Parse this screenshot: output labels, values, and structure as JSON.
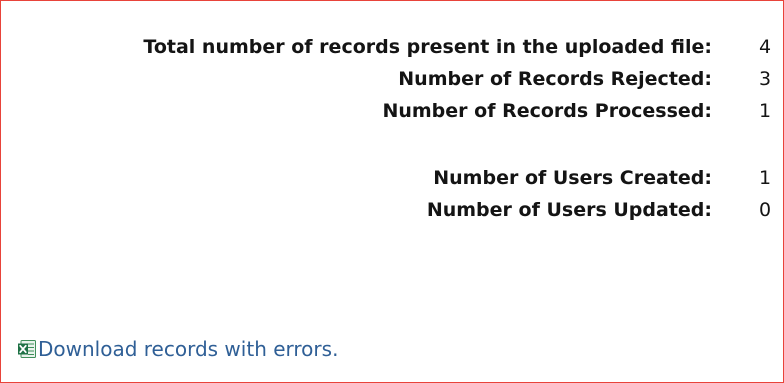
{
  "summary": {
    "rows": [
      {
        "label": "Total number of records present in the uploaded file:",
        "value": "4"
      },
      {
        "label": "Number of Records Rejected:",
        "value": "3"
      },
      {
        "label": "Number of Records Processed:",
        "value": "1"
      },
      {
        "label": "Number of Users Created:",
        "value": "1"
      },
      {
        "label": "Number of Users Updated:",
        "value": "0"
      }
    ]
  },
  "download": {
    "icon": "excel-icon",
    "label": "Download records with errors."
  },
  "colors": {
    "border": "#e8433a",
    "link": "#2f5f96",
    "text": "#141414",
    "icon_green": "#1e7145"
  }
}
